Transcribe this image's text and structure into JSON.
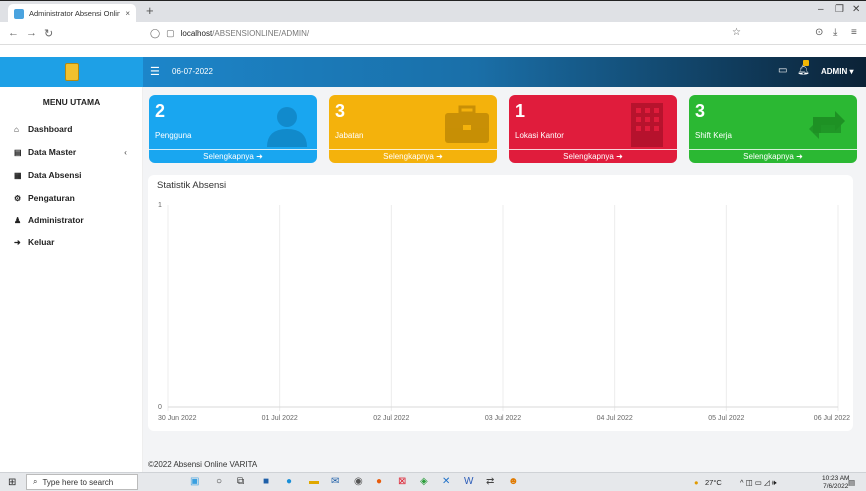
{
  "browser": {
    "tab_title": "Administrator Absensi Online V",
    "tab_close": "×",
    "new_tab": "+",
    "url_host": "localhost",
    "url_path": "/ABSENSIONLINE/ADMIN/"
  },
  "header": {
    "date": "06-07-2022",
    "user": "ADMIN ▾"
  },
  "sidebar": {
    "title": "MENU UTAMA",
    "items": [
      {
        "label": "Dashboard",
        "icon": "home-icon"
      },
      {
        "label": "Data Master",
        "icon": "database-icon",
        "chevron": "‹"
      },
      {
        "label": "Data Absensi",
        "icon": "table-icon"
      },
      {
        "label": "Pengaturan",
        "icon": "gears-icon"
      },
      {
        "label": "Administrator",
        "icon": "user-icon"
      },
      {
        "label": "Keluar",
        "icon": "sign-out-icon"
      }
    ]
  },
  "cards": [
    {
      "value": "2",
      "label": "Pengguna",
      "link": "Selengkapnya",
      "color": "#19a6f0",
      "icon": "user-icon"
    },
    {
      "value": "3",
      "label": "Jabatan",
      "link": "Selengkapnya",
      "color": "#f4b20c",
      "icon": "briefcase-icon"
    },
    {
      "value": "1",
      "label": "Lokasi Kantor",
      "link": "Selengkapnya",
      "color": "#e01c3c",
      "icon": "building-icon"
    },
    {
      "value": "3",
      "label": "Shift Kerja",
      "link": "Selengkapnya",
      "color": "#2bb833",
      "icon": "retweet-icon"
    }
  ],
  "chart_panel": {
    "title": "Statistik Absensi"
  },
  "chart_data": {
    "type": "line",
    "title": "Statistik Absensi",
    "categories": [
      "30 Jun 2022",
      "01 Jul 2022",
      "02 Jul 2022",
      "03 Jul 2022",
      "04 Jul 2022",
      "05 Jul 2022",
      "06 Jul 2022"
    ],
    "y_ticks": [
      "0",
      "1"
    ],
    "ylim": [
      0,
      1
    ],
    "grid": true
  },
  "footer": {
    "text": "©2022 Absensi Online VARITA"
  },
  "taskbar": {
    "search_placeholder": "Type here to search",
    "weather": "27°C",
    "time": "10:23 AM",
    "date": "7/6/2022"
  }
}
